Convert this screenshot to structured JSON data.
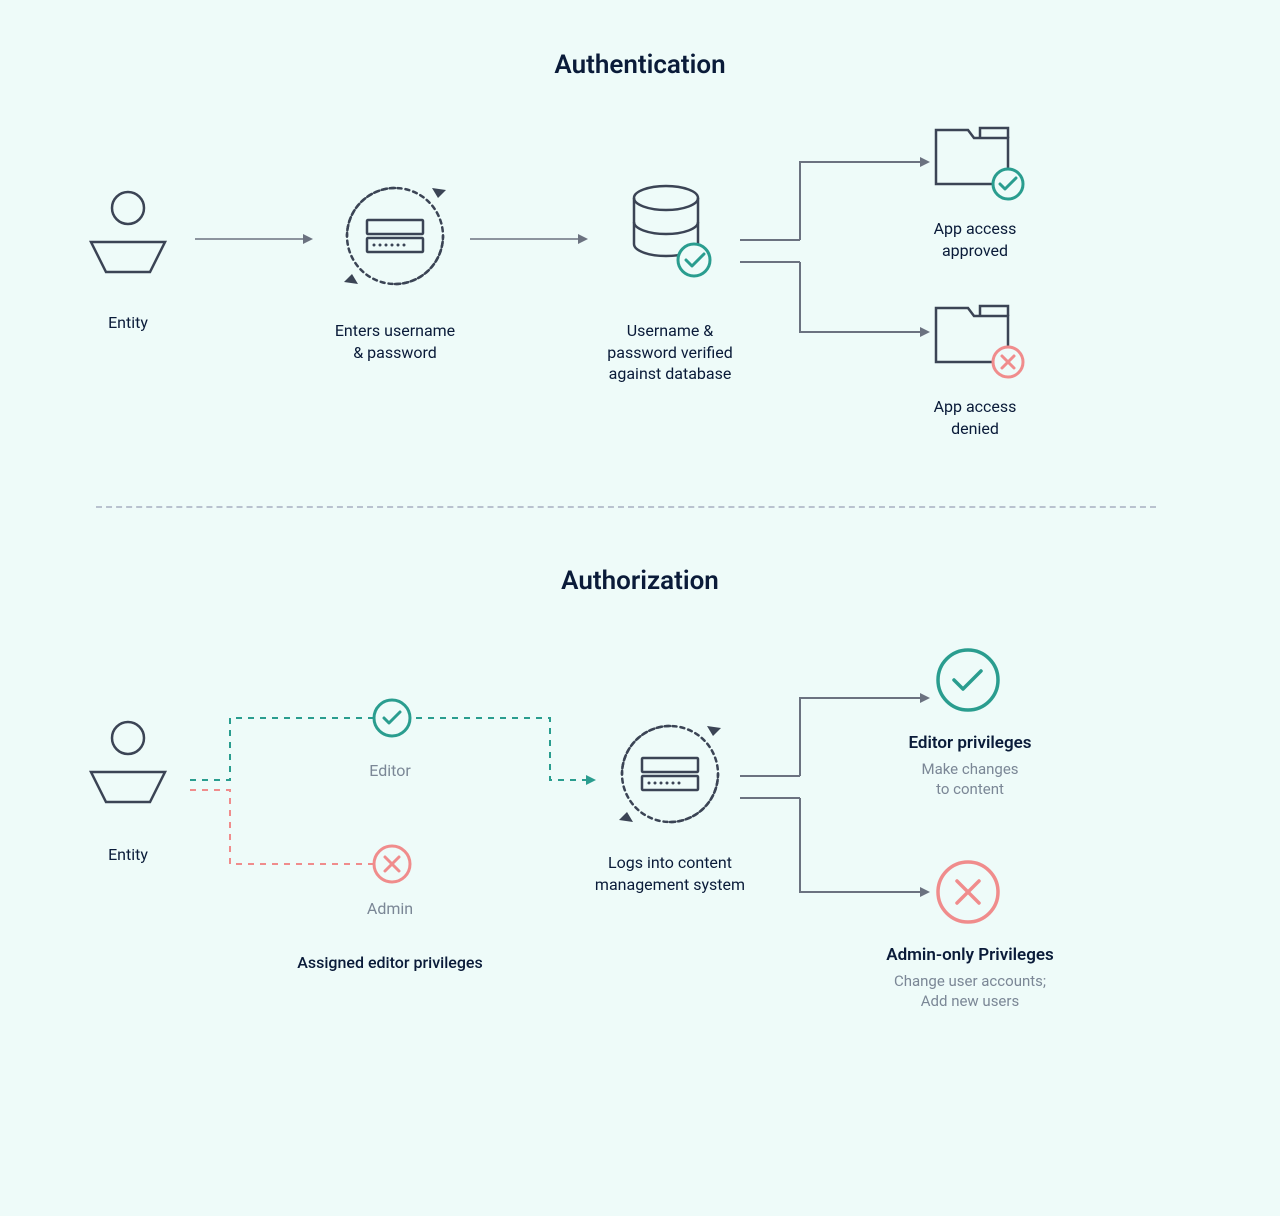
{
  "authentication": {
    "title": "Authentication",
    "entity_label": "Entity",
    "step2_label": "Enters username\n& password",
    "step3_label": "Username &\npassword verified\nagainst database",
    "approved_label": "App access\napproved",
    "denied_label": "App access\ndenied"
  },
  "authorization": {
    "title": "Authorization",
    "entity_label": "Entity",
    "editor_label": "Editor",
    "admin_label": "Admin",
    "assigned_label": "Assigned editor privileges",
    "login_label": "Logs into content\nmanagement system",
    "editor_priv_title": "Editor privileges",
    "editor_priv_sub": "Make changes\nto content",
    "admin_priv_title": "Admin-only Privileges",
    "admin_priv_sub": "Change user accounts;\nAdd new users"
  }
}
